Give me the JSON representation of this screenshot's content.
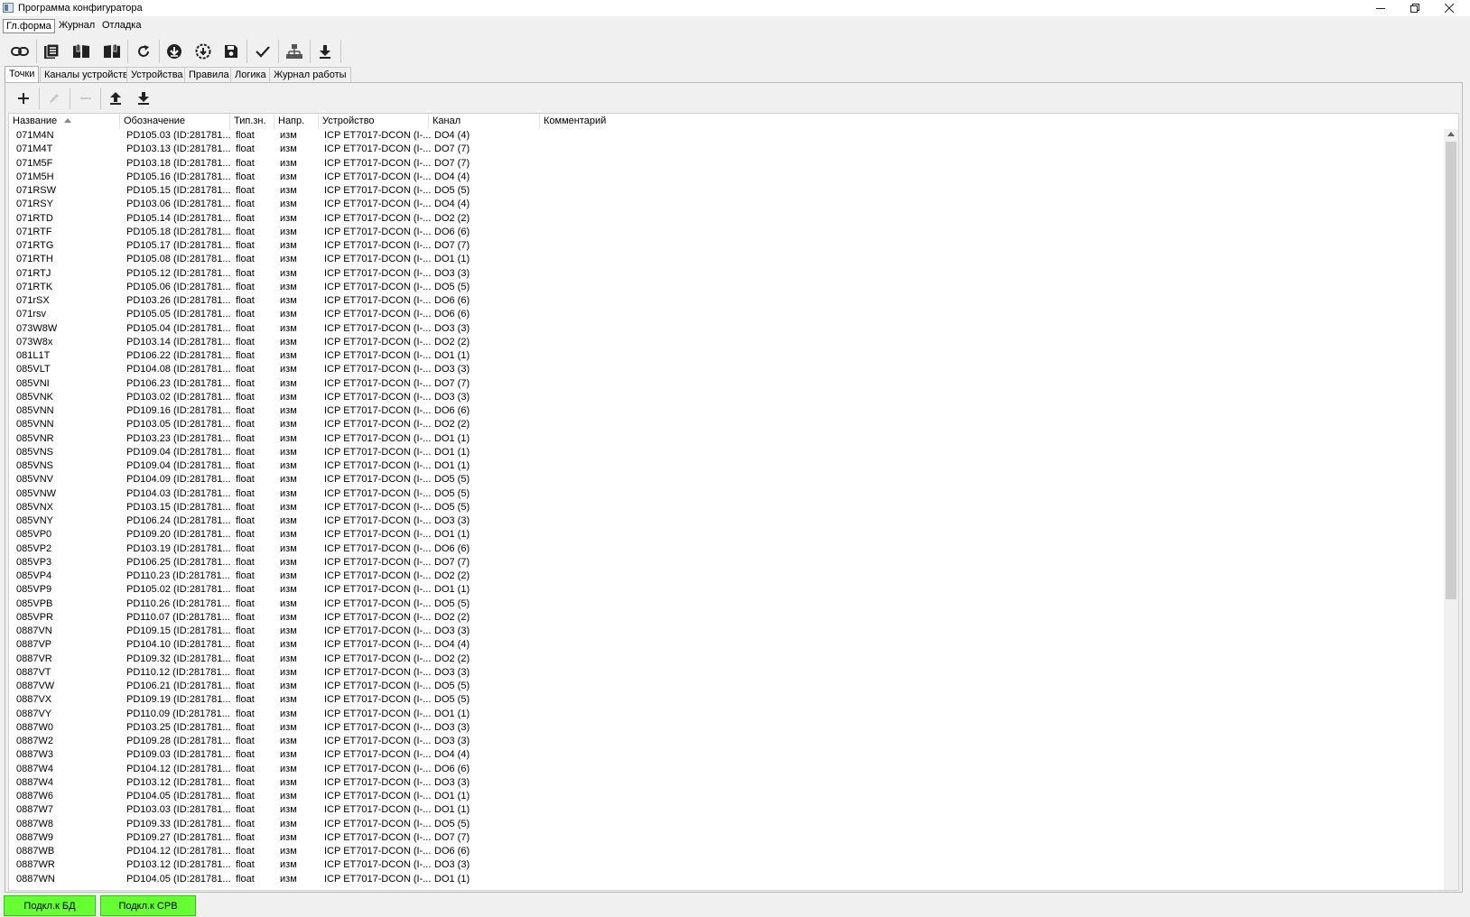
{
  "window": {
    "title": "Программа конфигуратора",
    "min_icon": "minimize-icon",
    "max_icon": "restore-icon",
    "close_icon": "close-icon"
  },
  "menu": [
    "Гл.форма",
    "Журнал",
    "Отладка"
  ],
  "toolbar_icons": [
    "link-icon",
    "open-list-icon",
    "book-icon",
    "book-open-icon",
    "refresh-icon",
    "download-circle-icon",
    "upload-circle-icon",
    "save-icon",
    "check-icon",
    "hierarchy-icon",
    "download-icon"
  ],
  "tabs": [
    "Точки",
    "Каналы устройств",
    "Устройства",
    "Правила",
    "Логика",
    "Журнал работы"
  ],
  "subtoolbar_icons": [
    "add-icon",
    "edit-icon",
    "remove-icon",
    "upload-arrow-icon",
    "download-arrow-icon"
  ],
  "columns": [
    "Название",
    "Обозначение",
    "Тип.зн.",
    "Напр.",
    "Устройство",
    "Канал",
    "Комментарий"
  ],
  "rows": [
    [
      "071M4N",
      "PD105.03 (ID:281781...",
      "float",
      "изм",
      "ICP ET7017-DCON (I-...",
      "DO4 (4)",
      ""
    ],
    [
      "071M4T",
      "PD103.13 (ID:281781...",
      "float",
      "изм",
      "ICP ET7017-DCON (I-...",
      "DO7 (7)",
      ""
    ],
    [
      "071M5F",
      "PD103.18 (ID:281781...",
      "float",
      "изм",
      "ICP ET7017-DCON (I-...",
      "DO7 (7)",
      ""
    ],
    [
      "071M5H",
      "PD105.16 (ID:281781...",
      "float",
      "изм",
      "ICP ET7017-DCON (I-...",
      "DO4 (4)",
      ""
    ],
    [
      "071RSW",
      "PD105.15 (ID:281781...",
      "float",
      "изм",
      "ICP ET7017-DCON (I-...",
      "DO5 (5)",
      ""
    ],
    [
      "071RSY",
      "PD103.06 (ID:281781...",
      "float",
      "изм",
      "ICP ET7017-DCON (I-...",
      "DO4 (4)",
      ""
    ],
    [
      "071RTD",
      "PD105.14 (ID:281781...",
      "float",
      "изм",
      "ICP ET7017-DCON (I-...",
      "DO2 (2)",
      ""
    ],
    [
      "071RTF",
      "PD105.18 (ID:281781...",
      "float",
      "изм",
      "ICP ET7017-DCON (I-...",
      "DO6 (6)",
      ""
    ],
    [
      "071RTG",
      "PD105.17 (ID:281781...",
      "float",
      "изм",
      "ICP ET7017-DCON (I-...",
      "DO7 (7)",
      ""
    ],
    [
      "071RTH",
      "PD105.08 (ID:281781...",
      "float",
      "изм",
      "ICP ET7017-DCON (I-...",
      "DO1 (1)",
      ""
    ],
    [
      "071RTJ",
      "PD105.12 (ID:281781...",
      "float",
      "изм",
      "ICP ET7017-DCON (I-...",
      "DO3 (3)",
      ""
    ],
    [
      "071RTK",
      "PD105.06 (ID:281781...",
      "float",
      "изм",
      "ICP ET7017-DCON (I-...",
      "DO5 (5)",
      ""
    ],
    [
      "071rSX",
      "PD103.26 (ID:281781...",
      "float",
      "изм",
      "ICP ET7017-DCON (I-...",
      "DO6 (6)",
      ""
    ],
    [
      "071rsv",
      "PD105.05 (ID:281781...",
      "float",
      "изм",
      "ICP ET7017-DCON (I-...",
      "DO6 (6)",
      ""
    ],
    [
      "073W8W",
      "PD105.04 (ID:281781...",
      "float",
      "изм",
      "ICP ET7017-DCON (I-...",
      "DO3 (3)",
      ""
    ],
    [
      "073W8x",
      "PD103.14 (ID:281781...",
      "float",
      "изм",
      "ICP ET7017-DCON (I-...",
      "DO2 (2)",
      ""
    ],
    [
      "081L1T",
      "PD106.22 (ID:281781...",
      "float",
      "изм",
      "ICP ET7017-DCON (I-...",
      "DO1 (1)",
      ""
    ],
    [
      "085VLT",
      "PD104.08 (ID:281781...",
      "float",
      "изм",
      "ICP ET7017-DCON (I-...",
      "DO3 (3)",
      ""
    ],
    [
      "085VNI",
      "PD106.23 (ID:281781...",
      "float",
      "изм",
      "ICP ET7017-DCON (I-...",
      "DO7 (7)",
      ""
    ],
    [
      "085VNK",
      "PD103.02 (ID:281781...",
      "float",
      "изм",
      "ICP ET7017-DCON (I-...",
      "DO3 (3)",
      ""
    ],
    [
      "085VNN",
      "PD109.16 (ID:281781...",
      "float",
      "изм",
      "ICP ET7017-DCON (I-...",
      "DO6 (6)",
      ""
    ],
    [
      "085VNN",
      "PD103.05 (ID:281781...",
      "float",
      "изм",
      "ICP ET7017-DCON (I-...",
      "DO2 (2)",
      ""
    ],
    [
      "085VNR",
      "PD103.23 (ID:281781...",
      "float",
      "изм",
      "ICP ET7017-DCON (I-...",
      "DO1 (1)",
      ""
    ],
    [
      "085VNS",
      "PD109.04 (ID:281781...",
      "float",
      "изм",
      "ICP ET7017-DCON (I-...",
      "DO1 (1)",
      ""
    ],
    [
      "085VNS",
      "PD109.04 (ID:281781...",
      "float",
      "изм",
      "ICP ET7017-DCON (I-...",
      "DO1 (1)",
      ""
    ],
    [
      "085VNV",
      "PD104.09 (ID:281781...",
      "float",
      "изм",
      "ICP ET7017-DCON (I-...",
      "DO5 (5)",
      ""
    ],
    [
      "085VNW",
      "PD104.03 (ID:281781...",
      "float",
      "изм",
      "ICP ET7017-DCON (I-...",
      "DO5 (5)",
      ""
    ],
    [
      "085VNX",
      "PD103.15 (ID:281781...",
      "float",
      "изм",
      "ICP ET7017-DCON (I-...",
      "DO5 (5)",
      ""
    ],
    [
      "085VNY",
      "PD106.24 (ID:281781...",
      "float",
      "изм",
      "ICP ET7017-DCON (I-...",
      "DO3 (3)",
      ""
    ],
    [
      "085VP0",
      "PD109.20 (ID:281781...",
      "float",
      "изм",
      "ICP ET7017-DCON (I-...",
      "DO1 (1)",
      ""
    ],
    [
      "085VP2",
      "PD103.19 (ID:281781...",
      "float",
      "изм",
      "ICP ET7017-DCON (I-...",
      "DO6 (6)",
      ""
    ],
    [
      "085VP3",
      "PD106.25 (ID:281781...",
      "float",
      "изм",
      "ICP ET7017-DCON (I-...",
      "DO7 (7)",
      ""
    ],
    [
      "085VP4",
      "PD110.23 (ID:281781...",
      "float",
      "изм",
      "ICP ET7017-DCON (I-...",
      "DO2 (2)",
      ""
    ],
    [
      "085VP9",
      "PD105.02 (ID:281781...",
      "float",
      "изм",
      "ICP ET7017-DCON (I-...",
      "DO1 (1)",
      ""
    ],
    [
      "085VPB",
      "PD110.26 (ID:281781...",
      "float",
      "изм",
      "ICP ET7017-DCON (I-...",
      "DO5 (5)",
      ""
    ],
    [
      "085VPR",
      "PD110.07 (ID:281781...",
      "float",
      "изм",
      "ICP ET7017-DCON (I-...",
      "DO2 (2)",
      ""
    ],
    [
      "0887VN",
      "PD109.15 (ID:281781...",
      "float",
      "изм",
      "ICP ET7017-DCON (I-...",
      "DO3 (3)",
      ""
    ],
    [
      "0887VP",
      "PD104.10 (ID:281781...",
      "float",
      "изм",
      "ICP ET7017-DCON (I-...",
      "DO4 (4)",
      ""
    ],
    [
      "0887VR",
      "PD109.32 (ID:281781...",
      "float",
      "изм",
      "ICP ET7017-DCON (I-...",
      "DO2 (2)",
      ""
    ],
    [
      "0887VT",
      "PD110.12 (ID:281781...",
      "float",
      "изм",
      "ICP ET7017-DCON (I-...",
      "DO3 (3)",
      ""
    ],
    [
      "0887VW",
      "PD106.21 (ID:281781...",
      "float",
      "изм",
      "ICP ET7017-DCON (I-...",
      "DO5 (5)",
      ""
    ],
    [
      "0887VX",
      "PD109.19 (ID:281781...",
      "float",
      "изм",
      "ICP ET7017-DCON (I-...",
      "DO5 (5)",
      ""
    ],
    [
      "0887VY",
      "PD110.09 (ID:281781...",
      "float",
      "изм",
      "ICP ET7017-DCON (I-...",
      "DO1 (1)",
      ""
    ],
    [
      "0887W0",
      "PD103.25 (ID:281781...",
      "float",
      "изм",
      "ICP ET7017-DCON (I-...",
      "DO3 (3)",
      ""
    ],
    [
      "0887W2",
      "PD109.28 (ID:281781...",
      "float",
      "изм",
      "ICP ET7017-DCON (I-...",
      "DO3 (3)",
      ""
    ],
    [
      "0887W3",
      "PD109.03 (ID:281781...",
      "float",
      "изм",
      "ICP ET7017-DCON (I-...",
      "DO4 (4)",
      ""
    ],
    [
      "0887W4",
      "PD104.12 (ID:281781...",
      "float",
      "изм",
      "ICP ET7017-DCON (I-...",
      "DO6 (6)",
      ""
    ],
    [
      "0887W4",
      "PD103.12 (ID:281781...",
      "float",
      "изм",
      "ICP ET7017-DCON (I-...",
      "DO3 (3)",
      ""
    ],
    [
      "0887W6",
      "PD104.05 (ID:281781...",
      "float",
      "изм",
      "ICP ET7017-DCON (I-...",
      "DO1 (1)",
      ""
    ],
    [
      "0887W7",
      "PD103.03 (ID:281781...",
      "float",
      "изм",
      "ICP ET7017-DCON (I-...",
      "DO1 (1)",
      ""
    ],
    [
      "0887W8",
      "PD109.33 (ID:281781...",
      "float",
      "изм",
      "ICP ET7017-DCON (I-...",
      "DO5 (5)",
      ""
    ],
    [
      "0887W9",
      "PD109.27 (ID:281781...",
      "float",
      "изм",
      "ICP ET7017-DCON (I-...",
      "DO7 (7)",
      ""
    ],
    [
      "0887WB",
      "PD104.12 (ID:281781...",
      "float",
      "изм",
      "ICP ET7017-DCON (I-...",
      "DO6 (6)",
      ""
    ],
    [
      "0887WR",
      "PD103.12 (ID:281781...",
      "float",
      "изм",
      "ICP ET7017-DCON (I-...",
      "DO3 (3)",
      ""
    ],
    [
      "0887WN",
      "PD104.05 (ID:281781...",
      "float",
      "изм",
      "ICP ET7017-DCON (I-...",
      "DO1 (1)",
      ""
    ]
  ],
  "status": {
    "db": "Подкл.к БД",
    "srv": "Подкл.к СРВ",
    "color": "#66ff33"
  }
}
